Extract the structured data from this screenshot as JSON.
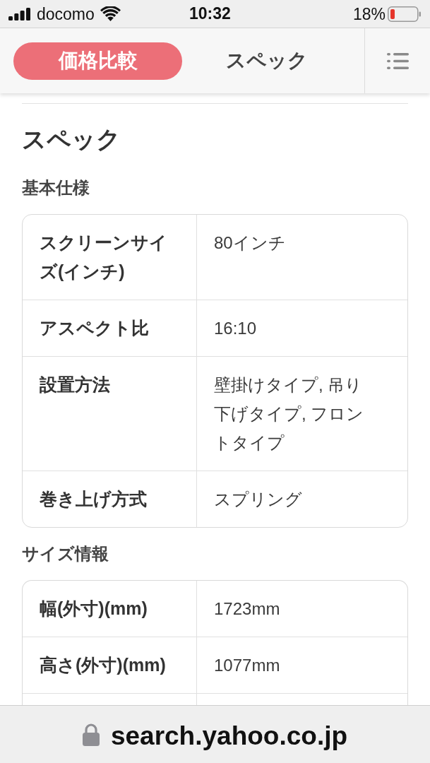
{
  "status_bar": {
    "carrier": "docomo",
    "time": "10:32",
    "battery": "18%"
  },
  "nav": {
    "tabs": [
      {
        "label": "価格比較",
        "selected": true
      },
      {
        "label": "スペック",
        "selected": false
      }
    ]
  },
  "content": {
    "title": "スペック",
    "sections": [
      {
        "heading": "基本仕様",
        "rows": [
          {
            "label": "スクリーンサイズ(インチ)",
            "value": "80インチ"
          },
          {
            "label": "アスペクト比",
            "value": "16:10"
          },
          {
            "label": "設置方法",
            "value": "壁掛けタイプ, 吊り下げタイプ, フロントタイプ"
          },
          {
            "label": "巻き上げ方式",
            "value": "スプリング"
          }
        ]
      },
      {
        "heading": "サイズ情報",
        "rows": [
          {
            "label": "幅(外寸)(mm)",
            "value": "1723mm"
          },
          {
            "label": "高さ(外寸)(mm)",
            "value": "1077mm"
          }
        ]
      }
    ]
  },
  "address_bar": {
    "url": "search.yahoo.co.jp"
  }
}
